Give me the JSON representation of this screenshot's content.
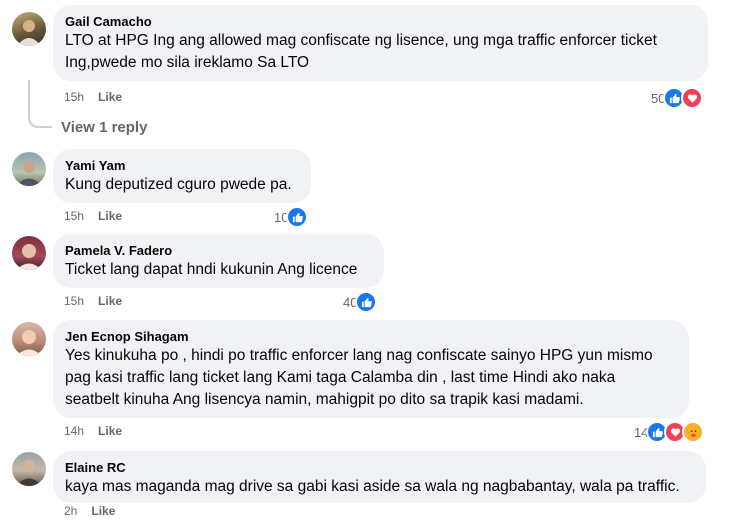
{
  "comments": [
    {
      "name": "Gail Camacho",
      "text_lines": [
        "LTO at HPG Ing ang allowed mag confiscate ng lisence, ung mga traffic enforcer ticket",
        "Ing,pwede mo sila ireklamo Sa LTO"
      ],
      "time": "15h",
      "like": "Like",
      "reaction_count": "50",
      "reactions": [
        "like-icon",
        "love-icon"
      ]
    },
    {
      "name": "Yami Yam",
      "text_lines": [
        "Kung deputized cguro pwede pa."
      ],
      "time": "15h",
      "like": "Like",
      "reaction_count": "10",
      "reactions": [
        "like-icon"
      ]
    },
    {
      "name": "Pamela V. Fadero",
      "text_lines": [
        "Ticket lang dapat hndi kukunin Ang licence"
      ],
      "time": "15h",
      "like": "Like",
      "reaction_count": "40",
      "reactions": [
        "like-icon"
      ]
    },
    {
      "name": "Jen Ecnop Sihagam",
      "text_lines": [
        "Yes kinukuha po , hindi po traffic enforcer lang nag confiscate sainyo HPG yun mismo",
        "pag kasi traffic lang ticket lang Kami taga Calamba din , last time Hindi ako naka",
        "seatbelt kinuha Ang lisencya namin, mahigpit po dito sa trapik kasi madami."
      ],
      "time": "14h",
      "like": "Like",
      "reaction_count": "14",
      "reactions": [
        "like-icon",
        "love-icon",
        "care-icon"
      ]
    },
    {
      "name": "Elaine RC",
      "text_lines": [
        "kaya mas maganda mag drive sa gabi kasi aside sa wala ng nagbabantay, wala pa traffic."
      ],
      "time": "2h",
      "like": "Like",
      "reaction_count": "",
      "reactions": []
    }
  ],
  "view_reply": "View 1 reply",
  "colors": {
    "bubble": "#f0f2f5",
    "like": "#1877f2",
    "love": "#f33e58",
    "care": "#f7b125",
    "meta": "#65676b"
  }
}
